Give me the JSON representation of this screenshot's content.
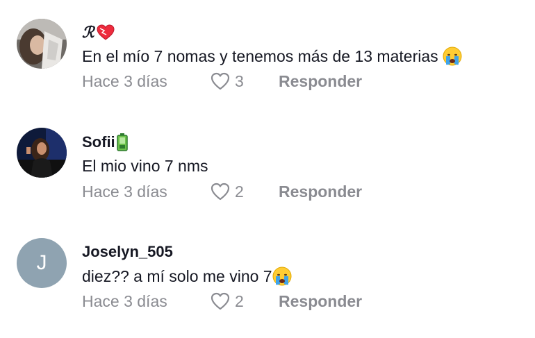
{
  "comments": [
    {
      "username": "ℛ",
      "username_emoji": "heart-icon",
      "text": "En el mío 7 nomas y tenemos más de 13 materias",
      "text_emoji": "crying-face-icon",
      "time": "Hace 3 días",
      "likes": "3",
      "reply_label": "Responder"
    },
    {
      "username": "Sofii",
      "username_emoji": "battery-low-icon",
      "text": "El mio vino 7 nms",
      "time": "Hace 3 días",
      "likes": "2",
      "reply_label": "Responder"
    },
    {
      "username": "Joselyn_505",
      "avatar_letter": "J",
      "text": "diez?? a mí solo me vino 7",
      "text_emoji": "crying-face-icon",
      "time": "Hace 3 días",
      "likes": "2",
      "reply_label": "Responder"
    }
  ],
  "colors": {
    "text": "#161823",
    "meta": "#8a8b91",
    "avatar_letter_bg": "#8fa3b1"
  }
}
